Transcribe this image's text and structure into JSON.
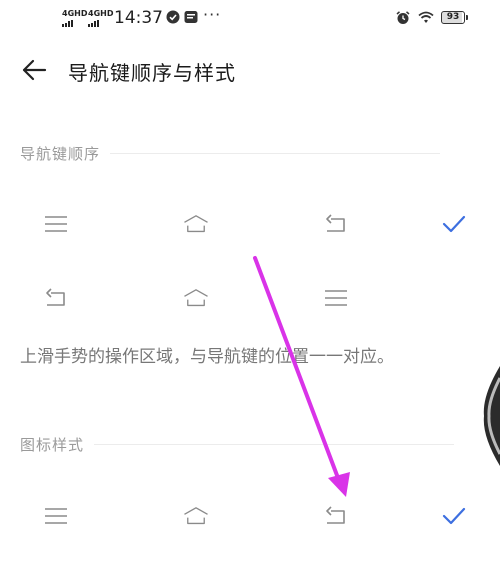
{
  "status_bar": {
    "sim1": "4GHD",
    "sim2": "4GHD",
    "time": "14:37",
    "more": "···",
    "battery": "93"
  },
  "header": {
    "title": "导航键顺序与样式"
  },
  "sections": {
    "order": {
      "title": "导航键顺序",
      "options": [
        {
          "icons": [
            "menu-icon",
            "home-icon",
            "back-icon"
          ],
          "selected": true
        },
        {
          "icons": [
            "back-icon",
            "home-icon",
            "menu-icon"
          ],
          "selected": false
        }
      ]
    },
    "description": "上滑手势的操作区域，与导航键的位置一一对应。",
    "style": {
      "title": "图标样式",
      "options": [
        {
          "icons": [
            "menu-icon",
            "home-icon",
            "back-icon"
          ],
          "selected": true
        }
      ]
    }
  },
  "colors": {
    "accent": "#3d6fe0",
    "icon": "#8a8a8a",
    "annotation_arrow": "#d933e8"
  }
}
